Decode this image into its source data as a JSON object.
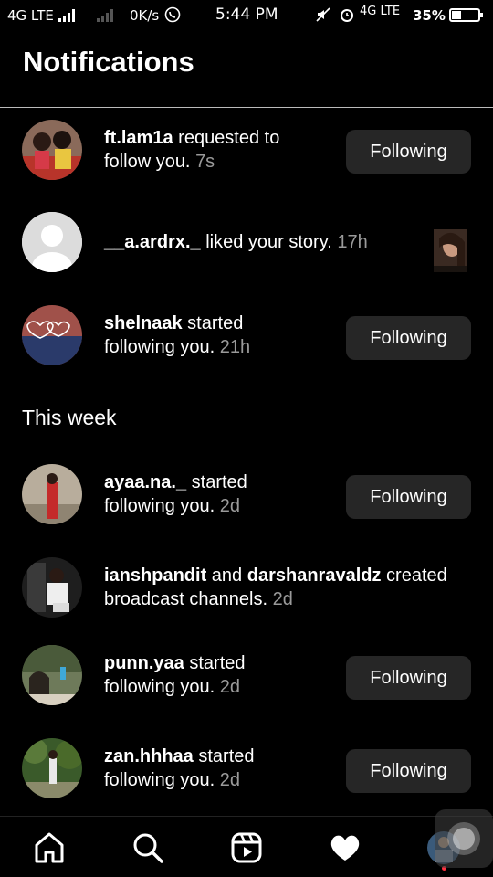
{
  "status_bar": {
    "network_left": "4G LTE",
    "speed": "0K/s",
    "time": "5:44 PM",
    "network_right": "4G LTE",
    "battery": "35%",
    "battery_level": 0.35
  },
  "header": {
    "title": "Notifications"
  },
  "recent": [
    {
      "username": "ft.lam1a",
      "action": "requested to",
      "action2": "follow you.",
      "time": "7s",
      "button": "Following"
    },
    {
      "username": "__a.ardrx._",
      "action": "liked your story.",
      "time": "17h"
    },
    {
      "username": "shelnaak",
      "action": "started",
      "action2": "following you.",
      "time": "21h",
      "button": "Following"
    }
  ],
  "this_week": {
    "label": "This week",
    "items": [
      {
        "username": "ayaa.na._",
        "action": "started",
        "action2": "following you.",
        "time": "2d",
        "button": "Following"
      },
      {
        "username": "ianshpandit",
        "and": "and",
        "username2": "darshanravaldz",
        "action": "created",
        "action2": "broadcast channels.",
        "time": "2d"
      },
      {
        "username": "punn.yaa",
        "action": "started",
        "action2": "following you.",
        "time": "2d",
        "button": "Following"
      },
      {
        "username": "zan.hhhaa",
        "action": "started",
        "action2": "following you.",
        "time": "2d",
        "button": "Following"
      }
    ]
  },
  "nav": {
    "items": [
      "home-icon",
      "search-icon",
      "reels-icon",
      "heart-icon",
      "profile-avatar"
    ]
  }
}
